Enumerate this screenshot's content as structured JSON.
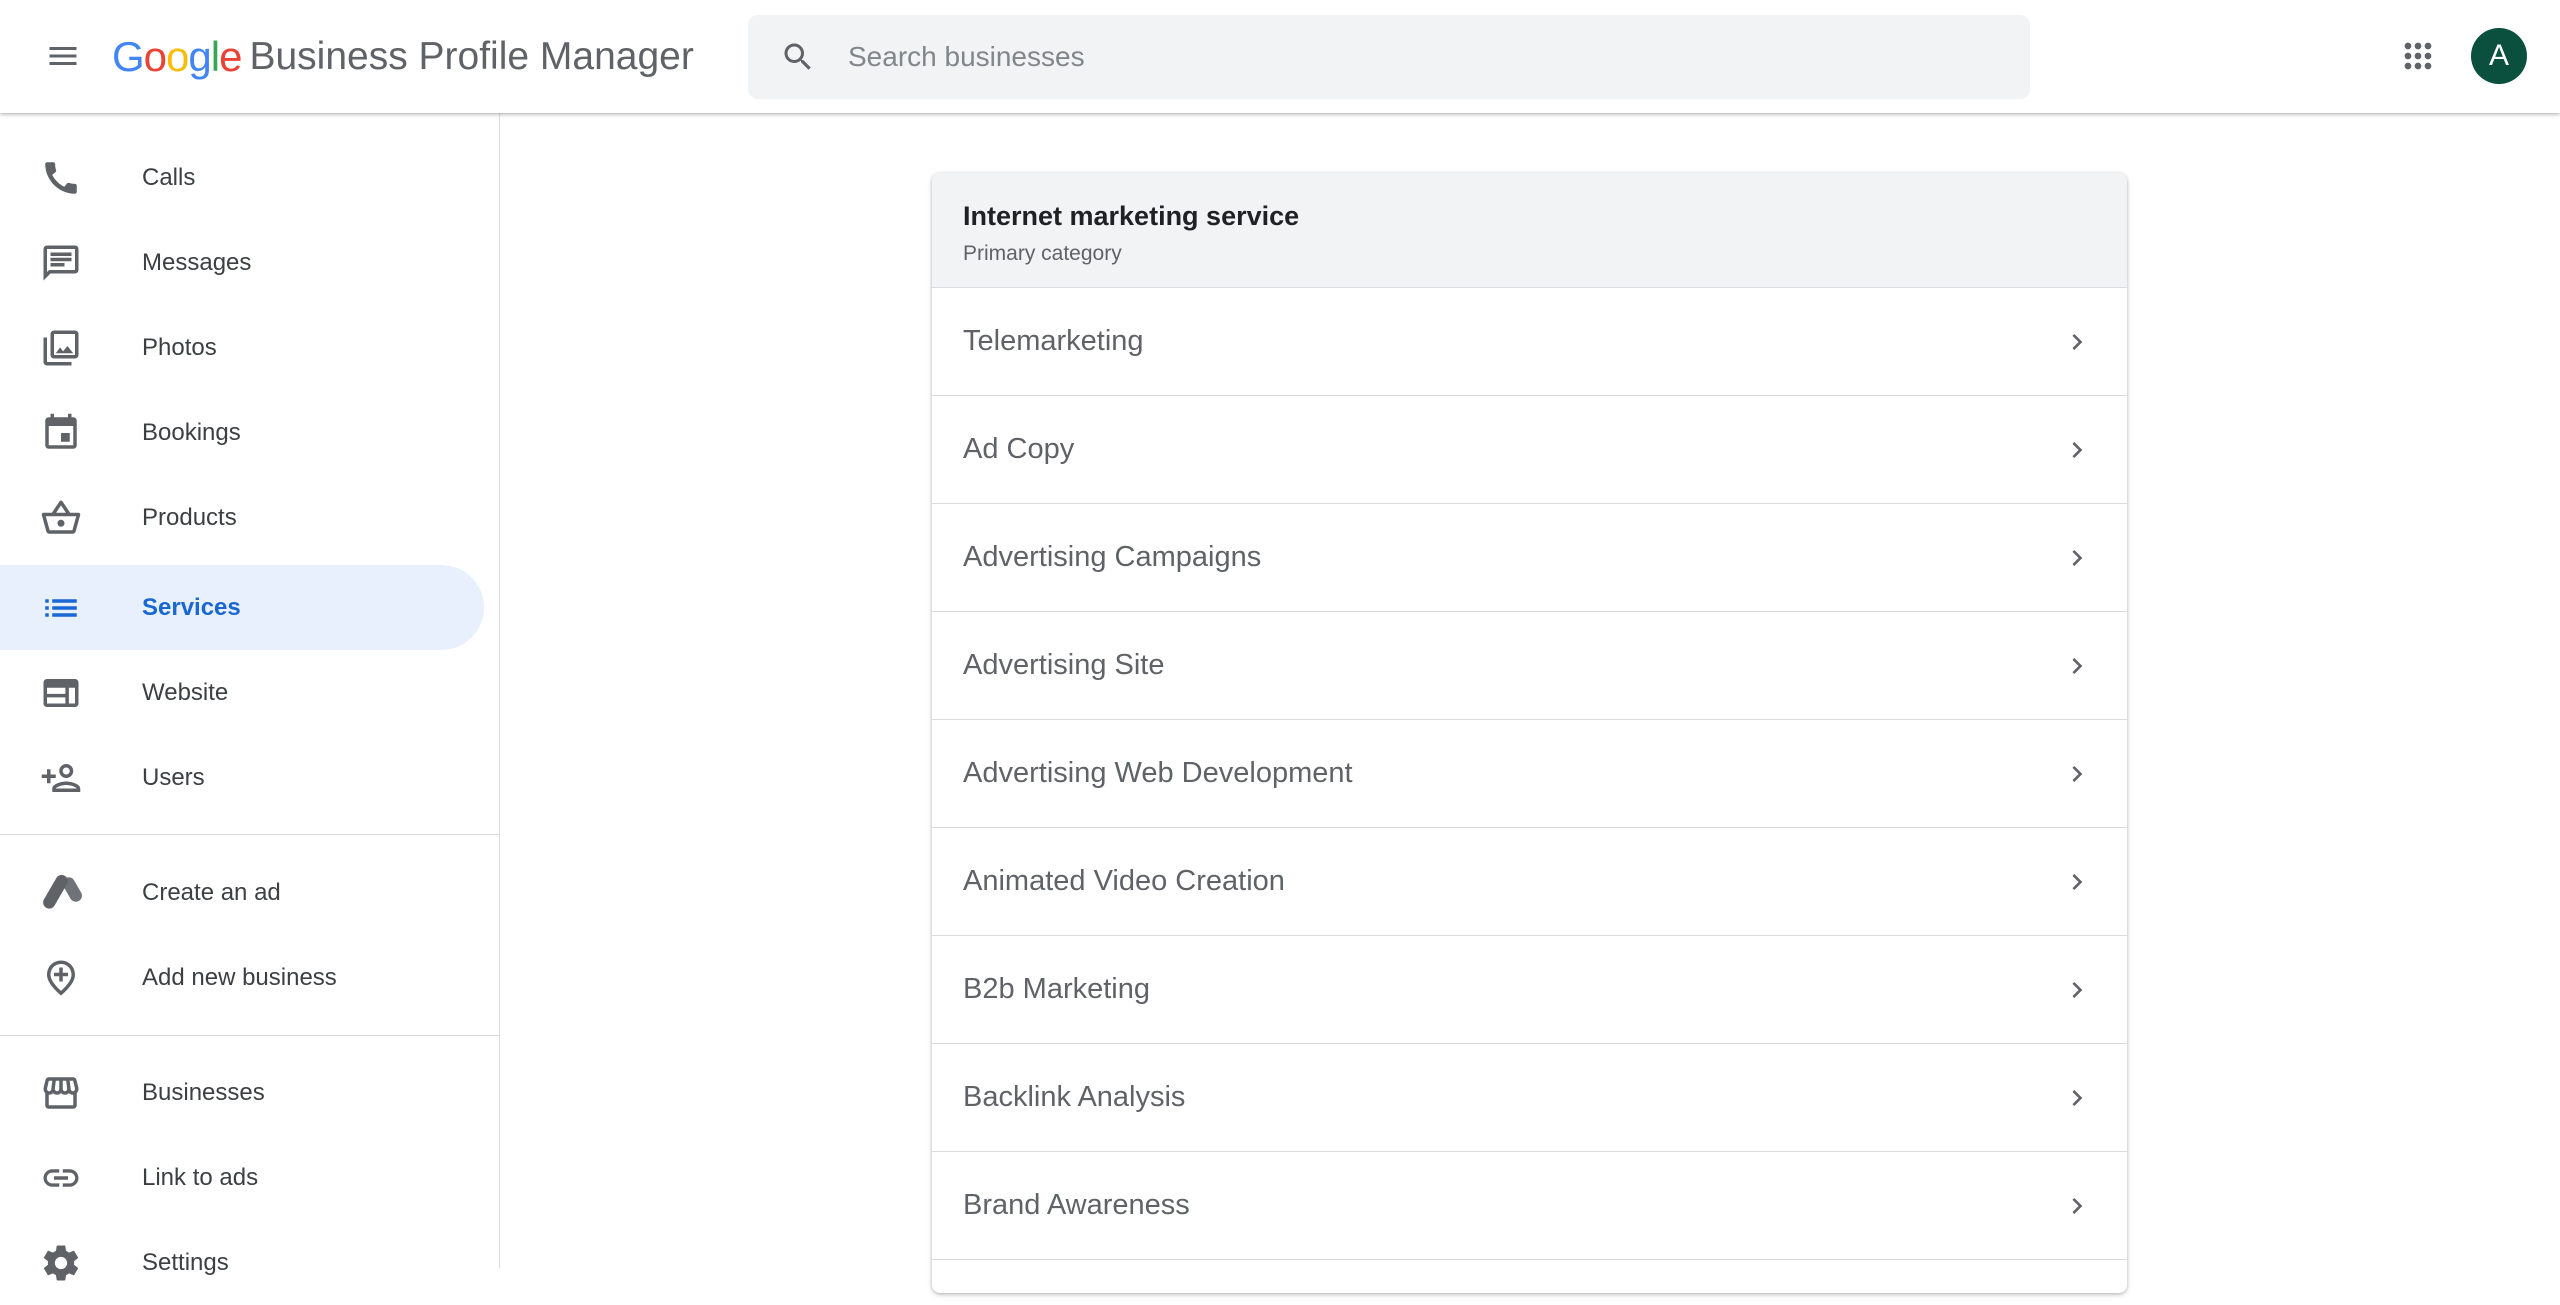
{
  "header": {
    "logo_letters": [
      {
        "ch": "G",
        "color": "#4285F4"
      },
      {
        "ch": "o",
        "color": "#EA4335"
      },
      {
        "ch": "o",
        "color": "#FBBC05"
      },
      {
        "ch": "g",
        "color": "#4285F4"
      },
      {
        "ch": "l",
        "color": "#34A853"
      },
      {
        "ch": "e",
        "color": "#EA4335"
      }
    ],
    "product_name": "Business Profile Manager",
    "search_placeholder": "Search businesses",
    "avatar_letter": "A",
    "avatar_color": "#0b4f3f"
  },
  "sidebar": {
    "items": [
      {
        "label": "Calls",
        "icon": "phone-icon",
        "active": false
      },
      {
        "label": "Messages",
        "icon": "message-icon",
        "active": false
      },
      {
        "label": "Photos",
        "icon": "photos-icon",
        "active": false
      },
      {
        "label": "Bookings",
        "icon": "calendar-icon",
        "active": false
      },
      {
        "label": "Products",
        "icon": "basket-icon",
        "active": false
      },
      {
        "label": "Services",
        "icon": "list-icon",
        "active": true
      },
      {
        "label": "Website",
        "icon": "website-icon",
        "active": false
      },
      {
        "label": "Users",
        "icon": "add-person-icon",
        "active": false
      }
    ],
    "secondary": [
      {
        "label": "Create an ad",
        "icon": "google-ads-icon"
      },
      {
        "label": "Add new business",
        "icon": "add-location-icon"
      }
    ],
    "tertiary": [
      {
        "label": "Businesses",
        "icon": "storefront-icon"
      },
      {
        "label": "Link to ads",
        "icon": "link-icon"
      },
      {
        "label": "Settings",
        "icon": "gear-icon"
      }
    ]
  },
  "services_card": {
    "category_title": "Internet marketing service",
    "category_subtitle": "Primary category",
    "services": [
      "Telemarketing",
      "Ad Copy",
      "Advertising Campaigns",
      "Advertising Site",
      "Advertising Web Development",
      "Animated Video Creation",
      "B2b Marketing",
      "Backlink Analysis",
      "Brand Awareness"
    ]
  },
  "colors": {
    "active_bg": "#e8f0fe",
    "active_text": "#1967d2",
    "icon": "#5f6368"
  }
}
